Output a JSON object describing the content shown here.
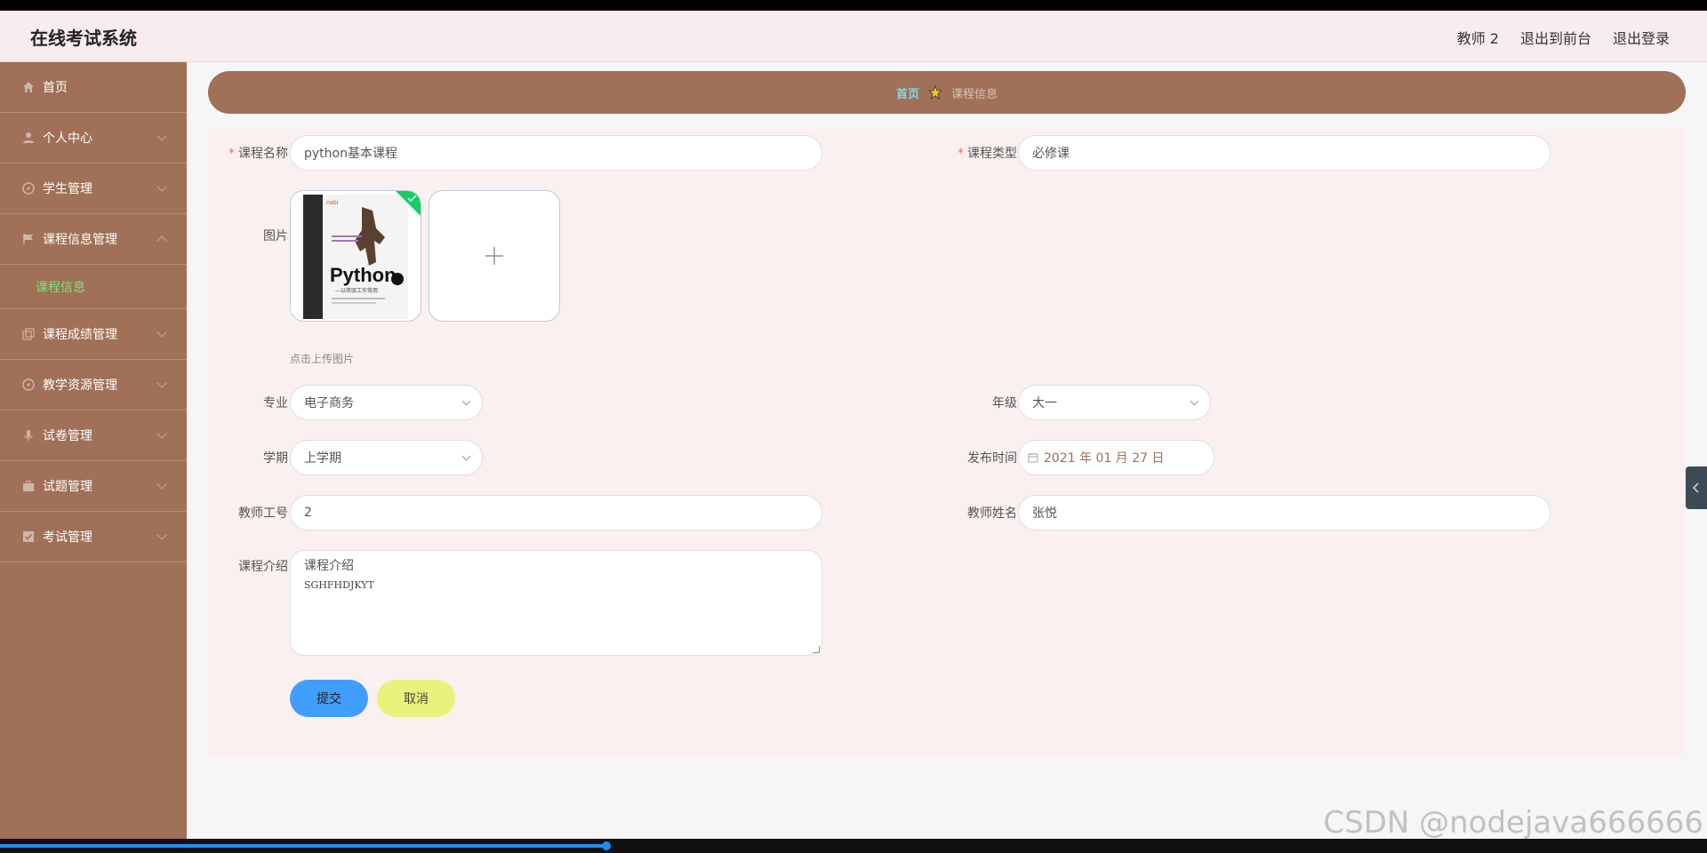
{
  "header": {
    "app_title": "在线考试系统",
    "user_label": "教师 2",
    "front_link": "退出到前台",
    "logout_link": "退出登录"
  },
  "sidebar": {
    "items": [
      {
        "label": "首页",
        "icon": "home-icon"
      },
      {
        "label": "个人中心",
        "icon": "user-icon"
      },
      {
        "label": "学生管理",
        "icon": "compass-icon"
      },
      {
        "label": "课程信息管理",
        "icon": "flag-icon",
        "expanded": true,
        "sub": "课程信息"
      },
      {
        "label": "课程成绩管理",
        "icon": "copy-icon"
      },
      {
        "label": "教学资源管理",
        "icon": "compass-icon"
      },
      {
        "label": "试卷管理",
        "icon": "microphone-icon"
      },
      {
        "label": "试题管理",
        "icon": "suitcase-icon"
      },
      {
        "label": "考试管理",
        "icon": "checkbox-icon"
      }
    ],
    "active_color": "#7de37d"
  },
  "breadcrumb": {
    "home": "首页",
    "current": "课程信息"
  },
  "form": {
    "course_name_label": "课程名称",
    "course_name_value": "python基本课程",
    "course_type_label": "课程类型",
    "course_type_value": "必修课",
    "image_label": "图片",
    "upload_tip": "点击上传图片",
    "book_cover": {
      "brand": "Python",
      "subtitle": "—以简驭工作常用"
    },
    "major_label": "专业",
    "major_value": "电子商务",
    "grade_label": "年级",
    "grade_value": "大一",
    "term_label": "学期",
    "term_value": "上学期",
    "publish_label": "发布时间",
    "publish_value": "2021 年 01 月 27 日",
    "teacher_no_label": "教师工号",
    "teacher_no_value": "2",
    "teacher_name_label": "教师姓名",
    "teacher_name_value": "张悦",
    "intro_label": "课程介绍",
    "intro_line1": "课程介绍",
    "intro_line2": "SGHFHDJKYT",
    "submit_label": "提交",
    "cancel_label": "取消"
  },
  "watermark": "CSDN @nodejava666666",
  "colors": {
    "sidebar": "#a07058",
    "header": "#f8ecef",
    "panel": "#f9f0ef",
    "primary": "#409eff",
    "cancel": "#e9f27a"
  },
  "video_progress": 0.355
}
